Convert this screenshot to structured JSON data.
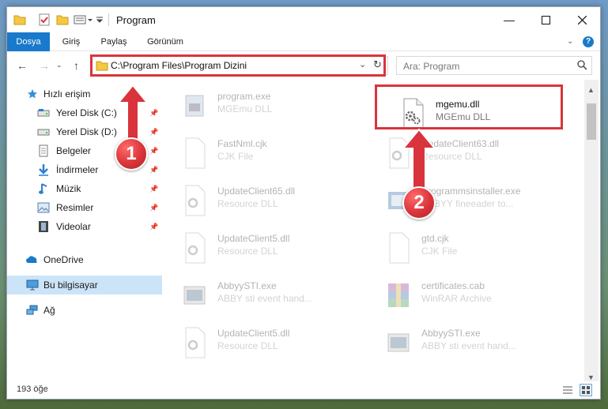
{
  "window": {
    "title": "Program"
  },
  "ribbon": {
    "tabs": [
      "Dosya",
      "Giriş",
      "Paylaş",
      "Görünüm"
    ]
  },
  "address": {
    "path": "C:\\Program Files\\Program Dizini"
  },
  "search": {
    "placeholder": "Ara: Program"
  },
  "nav": {
    "quick_access": "Hızlı erişim",
    "items": [
      "Yerel Disk (C:)",
      "Yerel Disk (D:)",
      "Belgeler",
      "İndirmeler",
      "Müzik",
      "Resimler",
      "Videolar"
    ],
    "onedrive": "OneDrive",
    "this_pc": "Bu bilgisayar",
    "network": "Ağ"
  },
  "files": [
    {
      "name": "program.exe",
      "type": "MGEmu DLL",
      "icon": "exe-icon"
    },
    {
      "name": "mgemu.dll",
      "type": "MGEmu DLL",
      "icon": "dll-gear-icon"
    },
    {
      "name": "FastNml.cjk",
      "type": "CJK File",
      "icon": "blank-file-icon"
    },
    {
      "name": "UpdateClient63.dll",
      "type": "Resource DLL",
      "icon": "dll-gear-icon"
    },
    {
      "name": "UpdateClient65.dll",
      "type": "Resource DLL",
      "icon": "dll-gear-icon"
    },
    {
      "name": "Programmsinstaller.exe",
      "type": "ABBYY fineeader to...",
      "icon": "installer-icon"
    },
    {
      "name": "UpdateClient5.dll",
      "type": "Resource DLL",
      "icon": "dll-gear-icon"
    },
    {
      "name": "gtd.cjk",
      "type": "CJK File",
      "icon": "blank-file-icon"
    },
    {
      "name": "AbbyySTI.exe",
      "type": "ABBY sti event hand...",
      "icon": "exe-icon"
    },
    {
      "name": "certificates.cab",
      "type": "WinRAR Archive",
      "icon": "winrar-icon"
    },
    {
      "name": "UpdateClient5.dll",
      "type": "Resource DLL",
      "icon": "dll-gear-icon"
    },
    {
      "name": "AbbyySTI.exe",
      "type": "ABBY sti event hand...",
      "icon": "exe-icon"
    }
  ],
  "status": {
    "count": "193 öğe"
  },
  "badges": [
    "1",
    "2"
  ],
  "colors": {
    "accent": "#1979ca",
    "highlight": "#d9343b"
  }
}
